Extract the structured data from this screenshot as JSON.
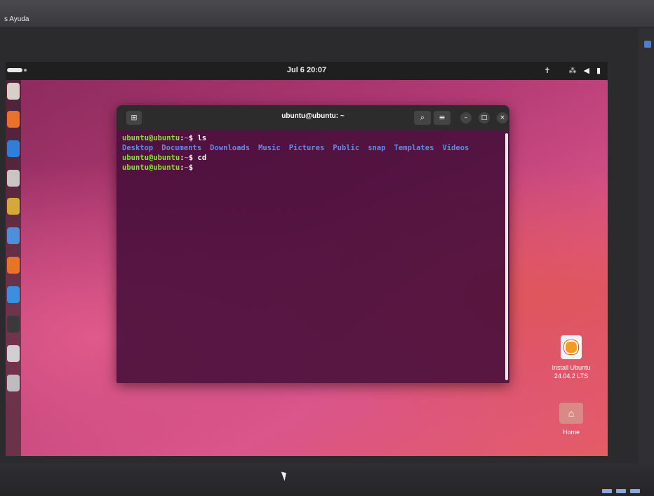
{
  "host": {
    "menu_label": "s  Ayuda"
  },
  "topbar": {
    "clock": "Jul 6  20:07",
    "tray_icons": [
      "accessibility-icon",
      "network-icon",
      "volume-icon",
      "battery-icon"
    ]
  },
  "dock": {
    "items": [
      "help-icon",
      "firefox-icon",
      "thunderbird-icon",
      "files-icon",
      "rhythmbox-icon",
      "writer-icon",
      "app-center-icon",
      "help-icon-2",
      "terminal-icon",
      "drive-icon",
      "drive-icon-2"
    ],
    "colors": [
      "#d8d0c8",
      "#e8712c",
      "#2f7fd8",
      "#c9c6c2",
      "#d4a83a",
      "#4f8ed8",
      "#e8742a",
      "#3c8fe0",
      "#3a3a3a",
      "#cfcfcf",
      "#bdbdbd"
    ]
  },
  "terminal": {
    "title": "ubuntu@ubuntu: ~",
    "lines": [
      {
        "user": "ubuntu@ubuntu",
        "sep": ":",
        "path": "~",
        "sym": "$ ",
        "cmd": "ls"
      },
      {
        "user": "ubuntu@ubuntu",
        "sep": ":",
        "path": "~",
        "sym": "$ ",
        "cmd": "cd"
      },
      {
        "user": "ubuntu@ubuntu",
        "sep": ":",
        "path": "~",
        "sym": "$ ",
        "cmd": ""
      }
    ],
    "dirs": [
      "Desktop",
      "Documents",
      "Downloads",
      "Music",
      "Pictures",
      "Public",
      "snap",
      "Templates",
      "Videos"
    ]
  },
  "desktop": {
    "install_label_1": "Install Ubuntu",
    "install_label_2": "24.04.2 LTS",
    "home_label": "Home"
  },
  "colors": {
    "prompt": "#8ae234",
    "path": "#729fcf",
    "directory": "#5c8ee6"
  }
}
